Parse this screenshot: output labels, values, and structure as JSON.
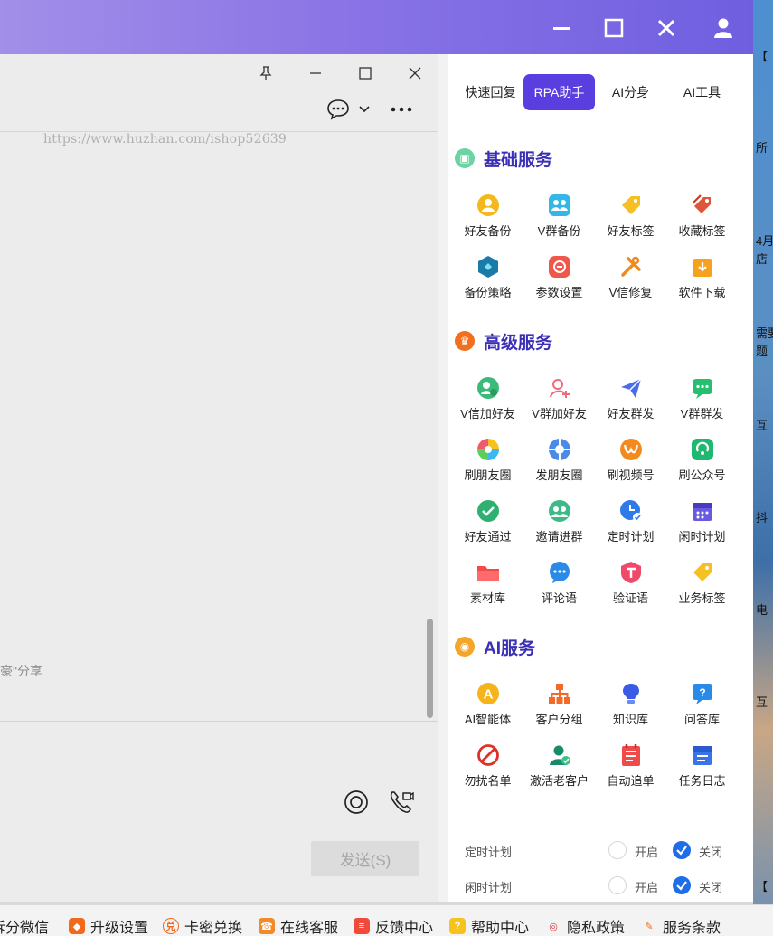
{
  "window": {
    "controls": [
      "minimize-icon",
      "maximize-icon",
      "close-icon",
      "user-icon"
    ]
  },
  "chat": {
    "watermark": "https://www.huzhan.com/ishop52639",
    "snippet": "豪\"分享",
    "send_label": "发送(S)"
  },
  "panel": {
    "tabs": [
      {
        "label": "快速回复",
        "active": false
      },
      {
        "label": "RPA助手",
        "active": true
      },
      {
        "label": "AI分身",
        "active": false
      },
      {
        "label": "AI工具",
        "active": false
      }
    ],
    "sections": {
      "basic": {
        "title": "基础服务",
        "items": [
          {
            "label": "好友备份",
            "icon": "friend-backup-icon"
          },
          {
            "label": "V群备份",
            "icon": "group-backup-icon"
          },
          {
            "label": "好友标签",
            "icon": "friend-tag-icon"
          },
          {
            "label": "收藏标签",
            "icon": "favorite-tag-icon"
          },
          {
            "label": "备份策略",
            "icon": "backup-strategy-icon"
          },
          {
            "label": "参数设置",
            "icon": "parameter-settings-icon"
          },
          {
            "label": "V信修复",
            "icon": "repair-icon"
          },
          {
            "label": "软件下载",
            "icon": "software-download-icon"
          }
        ]
      },
      "advanced": {
        "title": "高级服务",
        "items": [
          {
            "label": "V信加好友",
            "icon": "add-friend-icon"
          },
          {
            "label": "V群加好友",
            "icon": "group-add-friend-icon"
          },
          {
            "label": "好友群发",
            "icon": "friend-broadcast-icon"
          },
          {
            "label": "V群群发",
            "icon": "group-broadcast-icon"
          },
          {
            "label": "刷朋友圈",
            "icon": "browse-moments-icon"
          },
          {
            "label": "发朋友圈",
            "icon": "post-moments-icon"
          },
          {
            "label": "刷视频号",
            "icon": "browse-channels-icon"
          },
          {
            "label": "刷公众号",
            "icon": "browse-official-accounts-icon"
          },
          {
            "label": "好友通过",
            "icon": "friend-approve-icon"
          },
          {
            "label": "邀请进群",
            "icon": "invite-group-icon"
          },
          {
            "label": "定时计划",
            "icon": "scheduled-plan-icon"
          },
          {
            "label": "闲时计划",
            "icon": "idle-plan-icon"
          },
          {
            "label": "素材库",
            "icon": "material-library-icon"
          },
          {
            "label": "评论语",
            "icon": "comment-icon"
          },
          {
            "label": "验证语",
            "icon": "verification-icon"
          },
          {
            "label": "业务标签",
            "icon": "business-tag-icon"
          }
        ]
      },
      "ai": {
        "title": "AI服务",
        "items": [
          {
            "label": "AI智能体",
            "icon": "ai-agent-icon"
          },
          {
            "label": "客户分组",
            "icon": "customer-group-icon"
          },
          {
            "label": "知识库",
            "icon": "knowledge-base-icon"
          },
          {
            "label": "问答库",
            "icon": "qa-library-icon"
          },
          {
            "label": "勿扰名单",
            "icon": "do-not-disturb-icon"
          },
          {
            "label": "激活老客户",
            "icon": "reactivate-customer-icon"
          },
          {
            "label": "自动追单",
            "icon": "auto-follow-up-icon"
          },
          {
            "label": "任务日志",
            "icon": "task-log-icon"
          }
        ]
      }
    },
    "schedules": [
      {
        "label": "定时计划",
        "on_label": "开启",
        "off_label": "关闭",
        "state": "关闭"
      },
      {
        "label": "闲时计划",
        "on_label": "开启",
        "off_label": "关闭",
        "state": "关闭"
      }
    ]
  },
  "edge_fragments": [
    "【",
    "所",
    "4月",
    "店",
    "需要",
    "题",
    "互",
    "抖",
    "电",
    "互",
    "【"
  ],
  "taskbar": [
    {
      "label": "拆分微信"
    },
    {
      "label": "升级设置"
    },
    {
      "label": "卡密兑换"
    },
    {
      "label": "在线客服"
    },
    {
      "label": "反馈中心"
    },
    {
      "label": "帮助中心"
    },
    {
      "label": "隐私政策"
    },
    {
      "label": "服务条款"
    }
  ],
  "colors": {
    "accent": "#5a3ee0",
    "section_title": "#3a2fb5",
    "radio_checked": "#1f6ee8"
  }
}
